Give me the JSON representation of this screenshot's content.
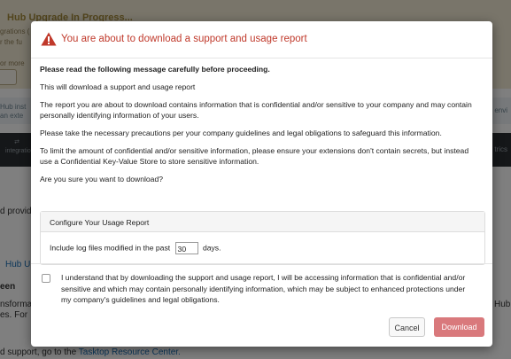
{
  "background": {
    "banner_title": "Hub Upgrade In Progress...",
    "side_fragments": [
      "grations (",
      "r the fu",
      "",
      "or more"
    ],
    "mid_fragments_left": [
      "Hub inst",
      "an exte"
    ],
    "mid_fragment_right": "n envi",
    "nav_left": "integratio",
    "nav_right": "trics",
    "text_provid": "d provid",
    "text_hub": "Hub U",
    "text_een": "een",
    "text_nsforma": "nsforma",
    "text_es_for": "es. For",
    "text_hub_right": "Hub",
    "bottom_text": "d support, go to the ",
    "bottom_link": "Tasktop Resource Center."
  },
  "modal": {
    "icon": "warning-triangle-icon",
    "title": "You are about to download a support and usage report",
    "intro_bold": "Please read the following message carefully before proceeding.",
    "line1": "This will download a support and usage report",
    "line2": "The report you are about to download contains information that is confidential and/or sensitive to your company and may contain personally identifying information of your users.",
    "line3": "Please take the necessary precautions per your company guidelines and legal obligations to safeguard this information.",
    "line4": "To limit the amount of confidential and/or sensitive information, please ensure your extensions don't contain secrets, but instead use a Confidential Key-Value Store to store sensitive information.",
    "line5": "Are you sure you want to download?",
    "config": {
      "title": "Configure Your Usage Report",
      "prefix": "Include log files modified in the past",
      "days_value": "30",
      "suffix": "days."
    },
    "consent": "I understand that by downloading the support and usage report, I will be accessing information that is confidential and/or sensitive and which may contain personally identifying information, which may be subject to enhanced protections under my company's guidelines and legal obligations.",
    "cancel_label": "Cancel",
    "download_label": "Download"
  },
  "colors": {
    "title_red": "#c0392b",
    "download_button": "#d9797c",
    "banner_bg": "#f3ead4",
    "nav_bg": "#2b2f33"
  }
}
